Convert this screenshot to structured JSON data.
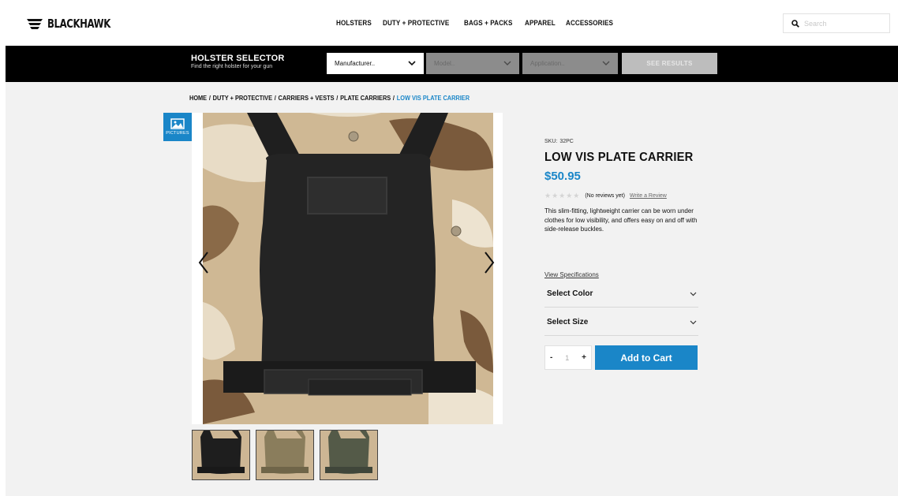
{
  "brand": {
    "logo_text": "BLACKHAWK",
    "accent_color": "#1a86c8"
  },
  "nav": {
    "items": [
      {
        "label": "HOLSTERS"
      },
      {
        "label": "DUTY + PROTECTIVE"
      },
      {
        "label": "BAGS + PACKS"
      },
      {
        "label": "APPAREL"
      },
      {
        "label": "ACCESSORIES"
      }
    ]
  },
  "search": {
    "placeholder": "Search",
    "icon": "search-icon"
  },
  "holster_selector": {
    "title": "HOLSTER SELECTOR",
    "subtitle": "Find the right holster for your gun",
    "manufacturer": "Manufacturer..",
    "model": "Model..",
    "application": "Application..",
    "button": "SEE RESULTS"
  },
  "breadcrumb": {
    "items": [
      "HOME",
      "DUTY + PROTECTIVE",
      "CARRIERS + VESTS",
      "PLATE CARRIERS"
    ],
    "separator": "/",
    "current": "LOW VIS PLATE CARRIER"
  },
  "gallery": {
    "pictures_label": "PICTURES"
  },
  "product": {
    "sku_label": "SKU:",
    "sku": "32PC",
    "title": "LOW VIS PLATE CARRIER",
    "price": "$50.95",
    "reviews_text": "(No reviews yet)",
    "write_review": "Write a Review",
    "description": "This slim-fitting, lightweight carrier can be worn under clothes for low visibility, and offers easy on and off with side-release buckles.",
    "view_specs": "View Specifications",
    "select_color": "Select Color",
    "select_size": "Select Size",
    "qty_minus": "-",
    "qty_value": "1",
    "qty_plus": "+",
    "add_to_cart": "Add to Cart"
  }
}
